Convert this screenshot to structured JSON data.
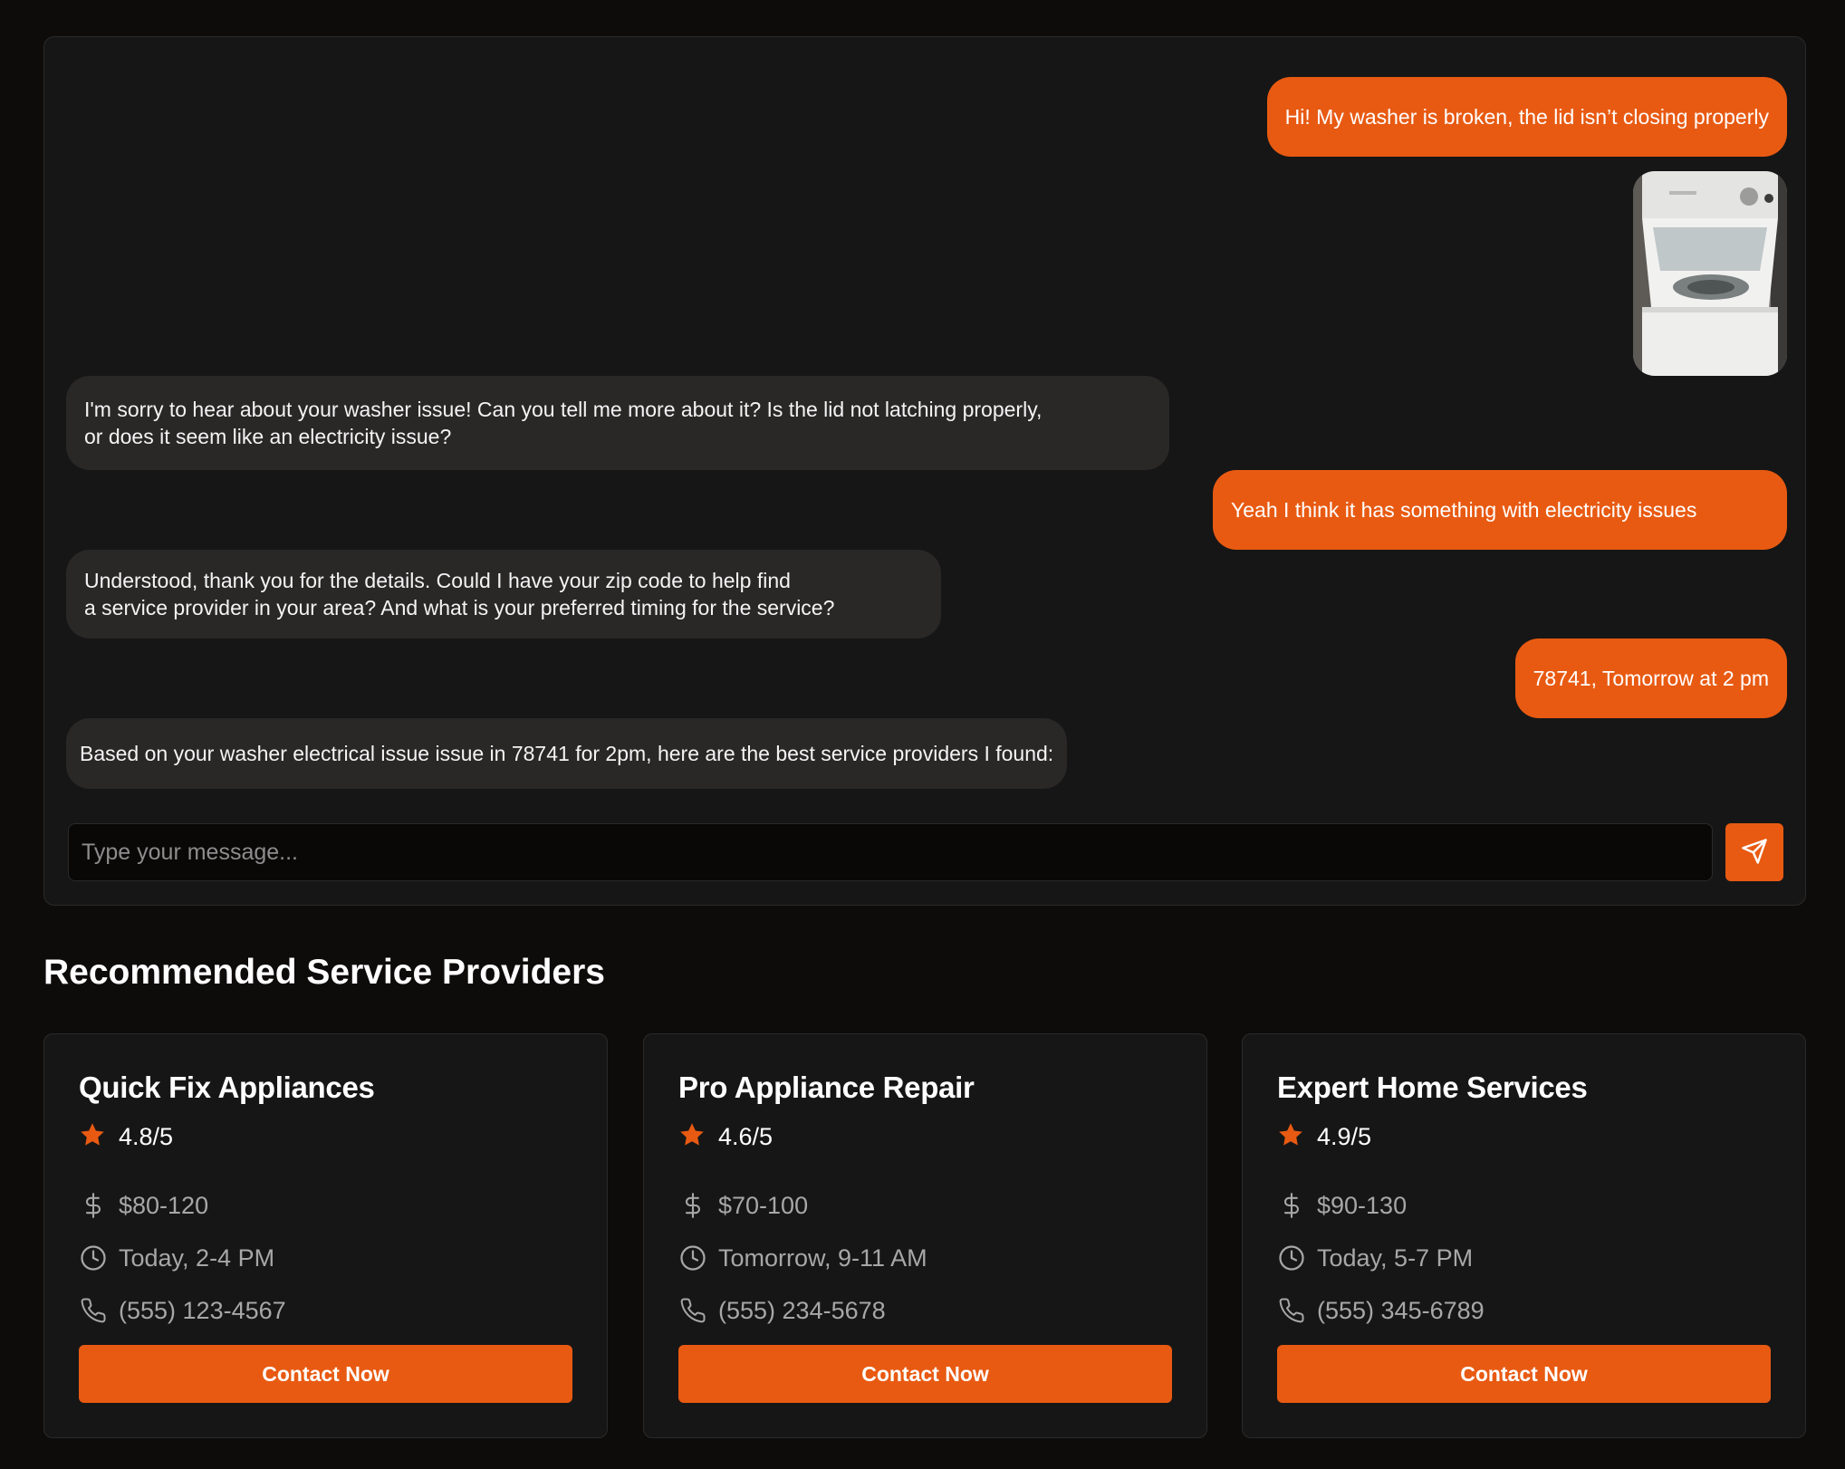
{
  "chat": {
    "messages": [
      {
        "role": "user",
        "text": "Hi! My washer is broken, the lid isn’t closing properly"
      },
      {
        "role": "user",
        "image": "washer-photo"
      },
      {
        "role": "assistant",
        "text": "I'm sorry to hear about your washer issue! Can you tell me more about it? Is the lid not latching properly,\n or does it seem like an electricity issue?"
      },
      {
        "role": "user",
        "text": "Yeah I think it has something with electricity issues"
      },
      {
        "role": "assistant",
        "text": "Understood, thank you for the details. Could I have your zip code to help find\na service provider in your area? And what is your preferred timing for the service?"
      },
      {
        "role": "user",
        "text": "78741, Tomorrow at 2 pm"
      },
      {
        "role": "assistant",
        "text": "Based on your washer electrical issue issue in 78741 for 2pm, here are the best service providers I found:"
      }
    ],
    "input_placeholder": "Type your message...",
    "input_value": "",
    "send_icon": "send-icon"
  },
  "providers_section": {
    "title": "Recommended Service Providers",
    "providers": [
      {
        "name": "Quick Fix Appliances",
        "rating": "4.8/5",
        "price": "$80-120",
        "availability": "Today, 2-4 PM",
        "phone": "(555) 123-4567",
        "cta": "Contact Now"
      },
      {
        "name": "Pro Appliance Repair",
        "rating": "4.6/5",
        "price": "$70-100",
        "availability": "Tomorrow, 9-11 AM",
        "phone": "(555) 234-5678",
        "cta": "Contact Now"
      },
      {
        "name": "Expert Home Services",
        "rating": "4.9/5",
        "price": "$90-130",
        "availability": "Today, 5-7 PM",
        "phone": "(555) 345-6789",
        "cta": "Contact Now"
      }
    ]
  },
  "colors": {
    "accent": "#e85a12",
    "background": "#0e0b0b",
    "panel": "#161616",
    "assistant_bubble": "#2a2727",
    "muted_text": "#a7a7a7"
  }
}
